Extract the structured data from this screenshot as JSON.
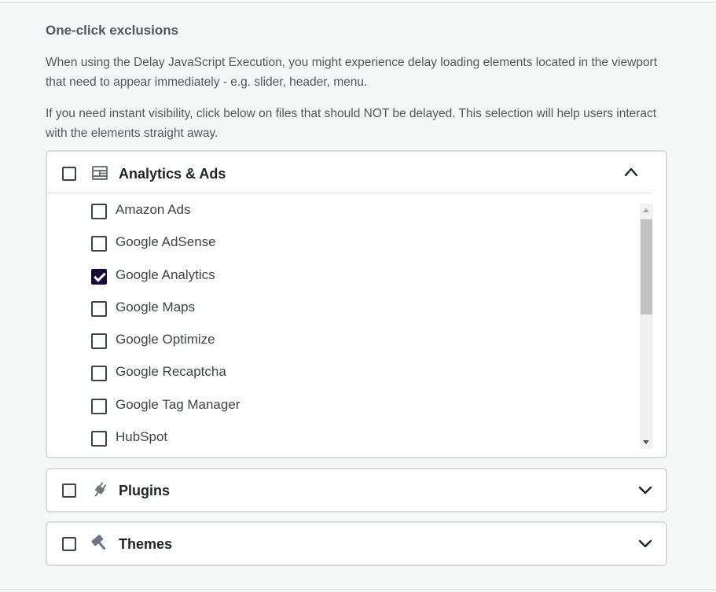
{
  "section": {
    "title": "One-click exclusions",
    "description_1": "When using the Delay JavaScript Execution, you might experience delay loading elements located in the viewport that need to appear immediately - e.g. slider, header, menu.",
    "description_2": "If you need instant visibility, click below on files that should NOT be delayed. This selection will help users interact with the elements straight away."
  },
  "groups": [
    {
      "title": "Analytics & Ads",
      "icon": "analytics-ads-icon",
      "expanded": true,
      "checked": false
    },
    {
      "title": "Plugins",
      "icon": "plugin-icon",
      "expanded": false,
      "checked": false
    },
    {
      "title": "Themes",
      "icon": "themes-icon",
      "expanded": false,
      "checked": false
    }
  ],
  "analytics_items": [
    {
      "label": "Amazon Ads",
      "checked": false
    },
    {
      "label": "Google AdSense",
      "checked": false
    },
    {
      "label": "Google Analytics",
      "checked": true
    },
    {
      "label": "Google Maps",
      "checked": false
    },
    {
      "label": "Google Optimize",
      "checked": false
    },
    {
      "label": "Google Recaptcha",
      "checked": false
    },
    {
      "label": "Google Tag Manager",
      "checked": false
    },
    {
      "label": "HubSpot",
      "checked": false
    }
  ],
  "colors": {
    "accent": "#1a0a3a",
    "text": "#50575e",
    "heading": "#1d2327",
    "border": "#dcdcde"
  }
}
